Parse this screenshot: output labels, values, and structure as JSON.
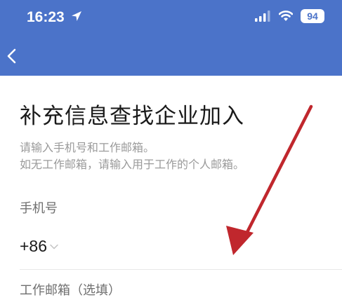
{
  "colors": {
    "header_bg": "#4b73c9",
    "battery_bg": "#ffffff",
    "battery_text": "#4b73c9",
    "annotation_arrow": "#c0272d"
  },
  "status_bar": {
    "time": "16:23",
    "battery_level": "94",
    "icons": [
      "location-arrow-icon",
      "signal-icon",
      "wifi-icon",
      "battery-icon"
    ]
  },
  "nav": {
    "back_icon": "chevron-left-icon"
  },
  "page": {
    "title": "补充信息查找企业加入",
    "subtitle_line1": "请输入手机号和工作邮箱。",
    "subtitle_line2": "如无工作邮箱，请输入用于工作的个人邮箱。"
  },
  "form": {
    "phone_label": "手机号",
    "country_code": "+86",
    "email_label": "工作邮箱（选填）"
  }
}
